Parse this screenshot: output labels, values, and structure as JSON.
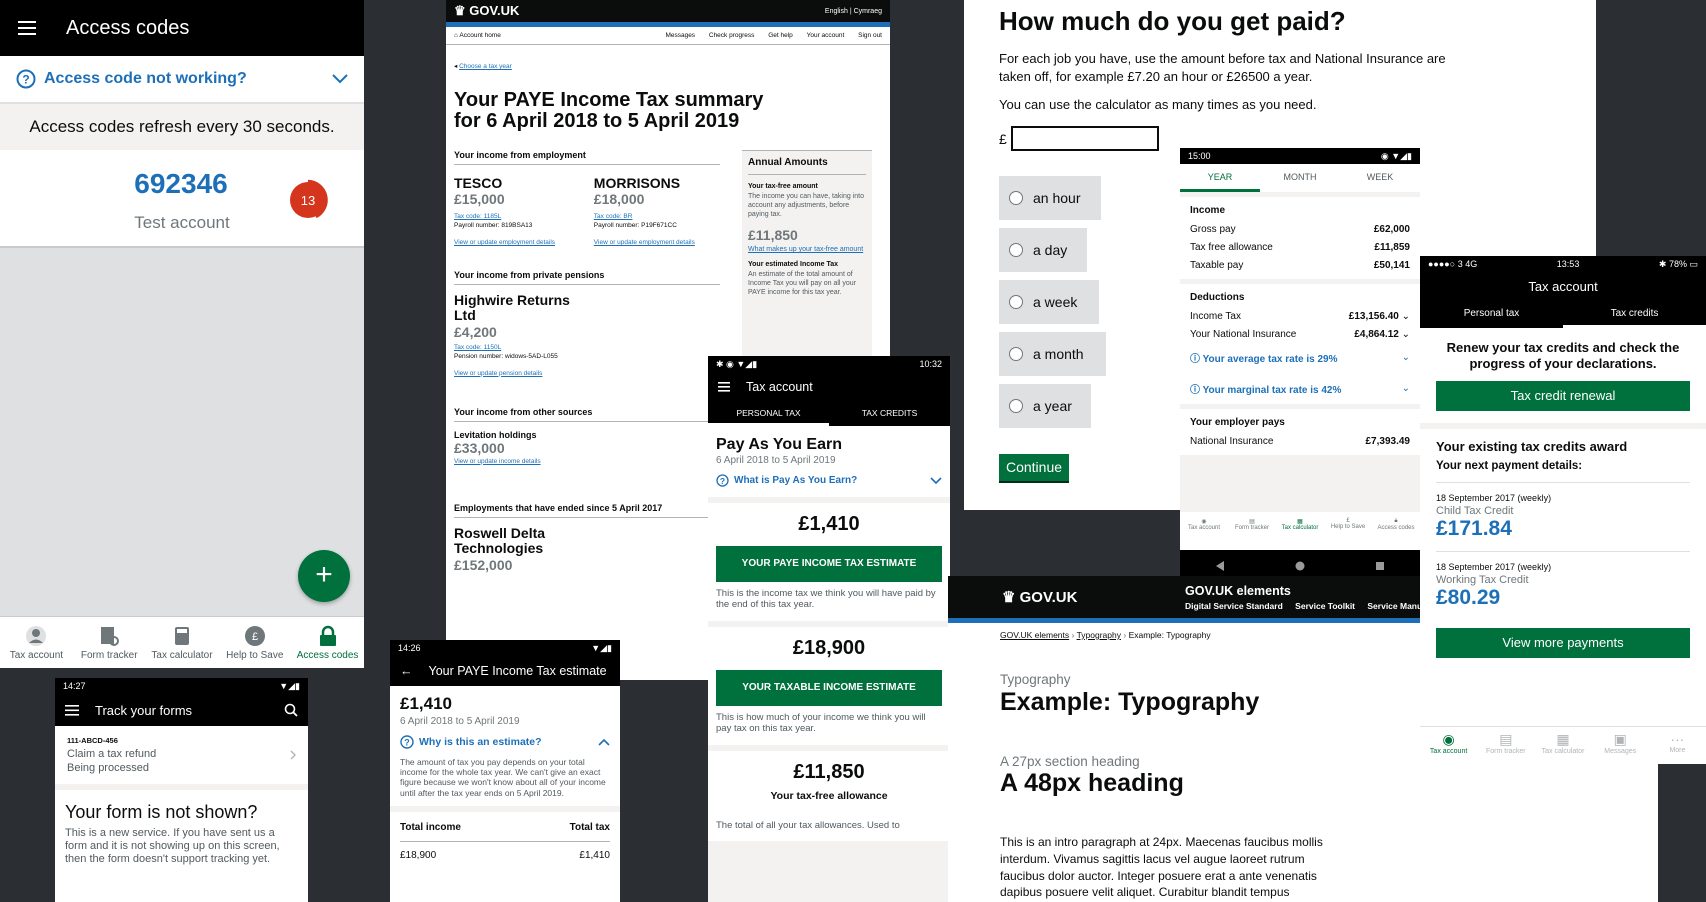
{
  "panel_access": {
    "title": "Access codes",
    "help_label": "Access code not working?",
    "refresh_text": "Access codes refresh every 30 seconds.",
    "code": "692346",
    "account_name": "Test account",
    "timer_seconds": "13",
    "fab_label": "+",
    "tabs": [
      "Tax account",
      "Form tracker",
      "Tax calculator",
      "Help to Save",
      "Access codes"
    ],
    "active_tab": "Access codes"
  },
  "panel_forms": {
    "status_time": "14:27",
    "title": "Track your forms",
    "ref": "111-ABCD-456",
    "item_title": "Claim a tax refund",
    "item_status": "Being processed",
    "heading": "Your form is not shown?",
    "body": "This is a new service. If you have sent us a form and it is not showing up on this screen, then the form doesn't support tracking yet."
  },
  "panel_summary": {
    "logo": "GOV.UK",
    "lang": "English | Cymraeg",
    "nav_home": "Account home",
    "nav_items": [
      "Messages",
      "Check progress",
      "Get help",
      "Your account",
      "Sign out"
    ],
    "back_link": "Choose a tax year",
    "heading": "Your PAYE Income Tax summary for 6 April 2018 to 5 April 2019",
    "emp_heading": "Your income from employment",
    "employers": [
      {
        "name": "TESCO",
        "amount": "£15,000",
        "code": "Tax code: 1185L",
        "payroll": "Payroll number: 819BSA13",
        "link": "View or update employment details"
      },
      {
        "name": "MORRISONS",
        "amount": "£18,000",
        "code": "Tax code: BR",
        "payroll": "Payroll number: P19F671CC",
        "link": "View or update employment details"
      }
    ],
    "pension_heading": "Your income from private pensions",
    "pension_name": "Highwire Returns Ltd",
    "pension_amount": "£4,200",
    "pension_code": "Tax code: 1150L",
    "pension_number": "Pension number: widows-5AD-L055",
    "pension_link": "View or update pension details",
    "other_heading": "Your income from other sources",
    "other_name": "Levitation holdings",
    "other_amount": "£33,000",
    "other_link": "View or update income details",
    "ended_heading": "Employments that have ended since 5 April 2017",
    "ended_name": "Roswell Delta Technologies",
    "ended_amount": "£152,000",
    "side_title": "Annual Amounts",
    "side_free_h": "Your tax-free amount",
    "side_free_p": "The income you can have, taking into account any adjustments, before paying tax.",
    "side_free_amt": "£11,850",
    "side_free_link": "What makes up your tax-free amount",
    "side_est_h": "Your estimated Income Tax",
    "side_est_p": "An estimate of the total amount of Income Tax you will pay on all your PAYE income for this tax year."
  },
  "panel_estimate": {
    "status_time": "14:26",
    "title": "Your PAYE Income Tax estimate",
    "amount": "£1,410",
    "period": "6 April 2018 to 5 April 2019",
    "why": "Why is this an estimate?",
    "why_text": "The amount of tax you pay depends on your total income for the whole tax year. We can't give an exact figure because we won't know about all of your income until after the tax year ends on 5 April 2019.",
    "col1": "Total income",
    "col2": "Total tax",
    "row_income": "£18,900",
    "row_tax": "£1,410"
  },
  "panel_payee": {
    "status_time": "10:32",
    "title": "Tax account",
    "tabs": [
      "PERSONAL TAX",
      "TAX CREDITS"
    ],
    "heading": "Pay As You Earn",
    "period": "6 April 2018 to 5 April 2019",
    "help": "What is Pay As You Earn?",
    "cards": [
      {
        "amount": "£1,410",
        "button": "YOUR PAYE INCOME TAX ESTIMATE",
        "note": "This is the income tax we think you will have paid by the end of this tax year."
      },
      {
        "amount": "£18,900",
        "button": "YOUR TAXABLE INCOME ESTIMATE",
        "note": "This is how much of your income we think you will pay tax on this tax year."
      },
      {
        "amount": "£11,850",
        "button": "Your tax-free allowance",
        "note": "The total of all your tax allowances. Used to"
      }
    ]
  },
  "panel_paid": {
    "heading": "How much do you get paid?",
    "p1": "For each job you have, use the amount before tax and National Insurance are taken off, for example £7.20 an hour or £26500 a year.",
    "p2": "You can use the calculator as many times as you need.",
    "currency": "£",
    "options": [
      "an hour",
      "a day",
      "a week",
      "a month",
      "a year"
    ],
    "continue": "Continue"
  },
  "panel_calc": {
    "status_time": "15:00",
    "tabs": [
      "YEAR",
      "MONTH",
      "WEEK"
    ],
    "income_h": "Income",
    "income_rows": [
      [
        "Gross pay",
        "£62,000"
      ],
      [
        "Tax free allowance",
        "£11,859"
      ],
      [
        "Taxable pay",
        "£50,141"
      ]
    ],
    "deductions_h": "Deductions",
    "deduction_rows": [
      [
        "Income Tax",
        "£13,156.40"
      ],
      [
        "Your National Insurance",
        "£4,864.12"
      ]
    ],
    "avg_rate": "Your average tax rate is 29%",
    "marg_rate": "Your marginal tax rate is 42%",
    "employer_h": "Your employer pays",
    "employer_row": [
      "National Insurance",
      "£7,393.49"
    ],
    "tabs_bottom": [
      "Tax account",
      "Form tracker",
      "Tax calculator",
      "Help to Save",
      "Access codes"
    ]
  },
  "panel_typo": {
    "logo": "GOV.UK",
    "site_title": "GOV.UK elements",
    "links": [
      "Digital Service Standard",
      "Service Toolkit",
      "Service Manual"
    ],
    "crumbs": [
      "GOV.UK elements",
      "Typography",
      "Example: Typography"
    ],
    "caption": "Typography",
    "h1": "Example: Typography",
    "caption2": "A 27px section heading",
    "h2": "A 48px heading",
    "intro": "This is an intro paragraph at 24px. Maecenas faucibus mollis interdum. Vivamus sagittis lacus vel augue laoreet rutrum faucibus dolor auctor. Integer posuere erat a ante venenatis dapibus posuere velit aliquet. Curabitur blandit tempus"
  },
  "panel_credits": {
    "status_carrier": "3  4G",
    "status_time": "13:53",
    "status_batt": "78%",
    "title": "Tax account",
    "tabs": [
      "Personal tax",
      "Tax credits"
    ],
    "renew_text": "Renew your tax credits and check the progress of your declarations.",
    "renew_btn": "Tax credit renewal",
    "award_h": "Your existing tax credits award",
    "next_h": "Your next payment details:",
    "payments": [
      {
        "date": "18 September 2017 (weekly)",
        "label": "Child Tax Credit",
        "amount": "£171.84"
      },
      {
        "date": "18 September 2017 (weekly)",
        "label": "Working Tax Credit",
        "amount": "£80.29"
      }
    ],
    "more_btn": "View more payments",
    "tabs_bottom": [
      "Tax account",
      "Form tracker",
      "Tax calculator",
      "Messages",
      "More"
    ]
  }
}
